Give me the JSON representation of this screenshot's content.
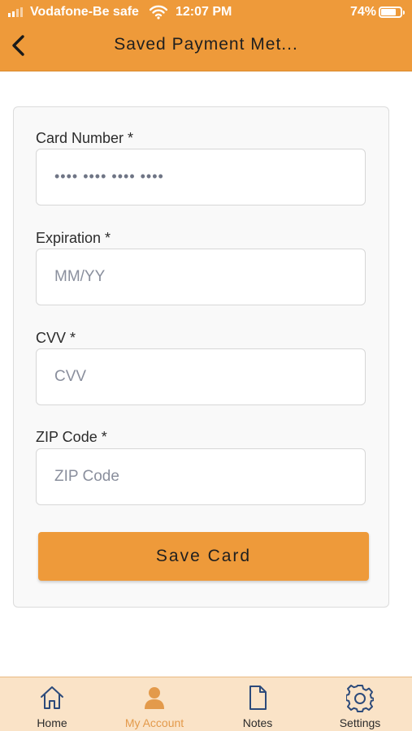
{
  "status_bar": {
    "carrier": "Vodafone-Be safe",
    "time": "12:07 PM",
    "battery": "74%"
  },
  "header": {
    "title": "Saved Payment Met..."
  },
  "form": {
    "card_number": {
      "label": "Card Number *",
      "placeholder": "•••• •••• •••• ••••",
      "value": ""
    },
    "expiration": {
      "label": "Expiration *",
      "placeholder": "MM/YY",
      "value": ""
    },
    "cvv": {
      "label": "CVV *",
      "placeholder": "CVV",
      "value": ""
    },
    "zip": {
      "label": "ZIP Code *",
      "placeholder": "ZIP Code",
      "value": ""
    },
    "save_label": "Save Card"
  },
  "tabs": [
    {
      "label": "Home",
      "icon": "home-icon"
    },
    {
      "label": "My Account",
      "icon": "person-icon",
      "active": true
    },
    {
      "label": "Notes",
      "icon": "document-icon"
    },
    {
      "label": "Settings",
      "icon": "gear-icon"
    }
  ],
  "colors": {
    "accent": "#ee9a3a",
    "tab_bar_bg": "#fae3c7",
    "active_tab": "#e39a4b"
  }
}
